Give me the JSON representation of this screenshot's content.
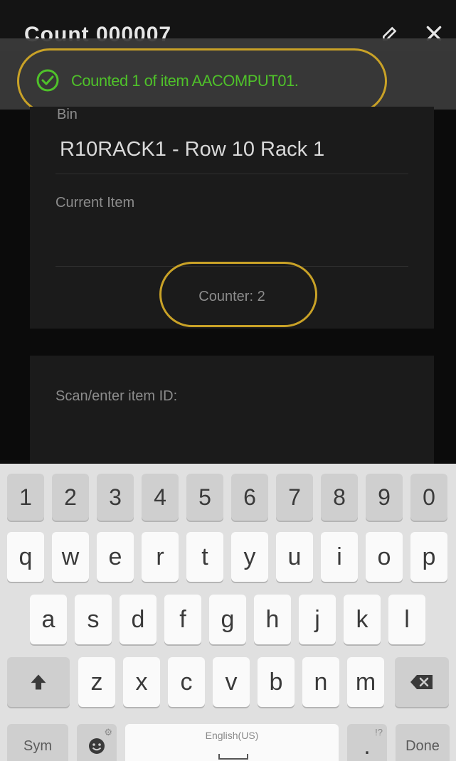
{
  "app_bar": {
    "title": "Count 000007",
    "icons": [
      "edit-icon",
      "close-icon"
    ]
  },
  "toast": {
    "message": "Counted 1 of item AACOMPUT01.",
    "icon": "check-circle-icon",
    "color": "#4fc12a",
    "highlight_color": "#c9a227"
  },
  "location_card": {
    "bin_label": "Bin",
    "bin_value": "R10RACK1 - Row 10 Rack 1",
    "current_item_label": "Current Item",
    "current_item_value": "",
    "counter_text": "Counter: 2"
  },
  "scan_card": {
    "label": "Scan/enter item ID:",
    "value": "",
    "accent": "#2f7fc1"
  },
  "keyboard": {
    "row_numbers": [
      "1",
      "2",
      "3",
      "4",
      "5",
      "6",
      "7",
      "8",
      "9",
      "0"
    ],
    "row_top": [
      "q",
      "w",
      "e",
      "r",
      "t",
      "y",
      "u",
      "i",
      "o",
      "p"
    ],
    "row_middle": [
      "a",
      "s",
      "d",
      "f",
      "g",
      "h",
      "j",
      "k",
      "l"
    ],
    "row_bottom": [
      "z",
      "x",
      "c",
      "v",
      "b",
      "n",
      "m"
    ],
    "shift_icon": "shift-arrow-icon",
    "backspace_icon": "backspace-icon",
    "sym_label": "Sym",
    "emoji_icon": "emoji-icon",
    "space_label": "English(US)",
    "period_label": ".",
    "done_label": "Done"
  }
}
